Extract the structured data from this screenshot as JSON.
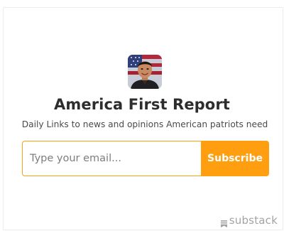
{
  "header": {
    "title": "America First Report",
    "subtitle": "Daily Links to news and opinions American patriots need"
  },
  "form": {
    "email_placeholder": "Type your email...",
    "email_value": "",
    "subscribe_label": "Subscribe"
  },
  "footer": {
    "brand_label": "substack",
    "brand_icon": "substack-logo-icon"
  },
  "colors": {
    "accent": "#ff9e0f",
    "title_text": "#2d2d2d",
    "subtitle_text": "#4a4a4a",
    "brand_text": "#a3a3a3"
  }
}
